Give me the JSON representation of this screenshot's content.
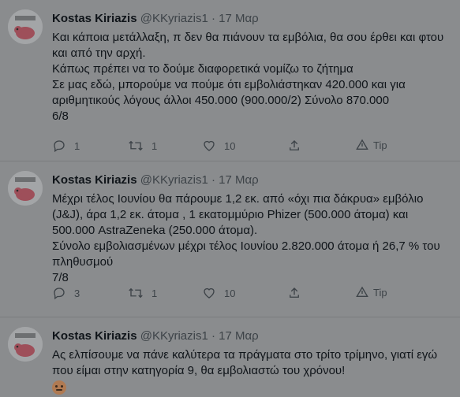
{
  "tweets": [
    {
      "author": "Kostas Kiriazis",
      "handle": "@KKyriazis1",
      "separator": "·",
      "date": "17 Μαρ",
      "lines": [
        "Και κάποια μετάλλαξη, π δεν θα πιάνουν τα εμβόλια, θα σου έρθει και φτου και από την αρχή.",
        "Κάπως πρέπει να το δούμε διαφορετικά νομίζω το ζήτημα",
        "Σε μας εδώ, μπορούμε να πούμε ότι εμβολιάστηκαν 420.000 και για αριθμητικούς λόγους άλλοι  450.000 (900.000/2)  Σύνολο 870.000",
        "6/8"
      ],
      "replies": "1",
      "retweets": "1",
      "likes": "10",
      "tip": "Tip"
    },
    {
      "author": "Kostas Kiriazis",
      "handle": "@KKyriazis1",
      "separator": "·",
      "date": "17 Μαρ",
      "lines": [
        "Μέχρι τέλος Ιουνίου θα πάρουμε  1,2 εκ.  από  «όχι πια δάκρυα» εμβόλιο (J&J), άρα 1,2 εκ. άτομα , 1 εκατομμύριο Phizer (500.000 άτομα)  και 500.000 AstraZeneka (250.000 άτομα).",
        "Σύνολο εμβολιασμένων μέχρι τέλος Ιουνίου  2.820.000 άτομα ή 26,7 % του πληθυσμού",
        "7/8"
      ],
      "replies": "3",
      "retweets": "1",
      "likes": "10",
      "tip": "Tip"
    },
    {
      "author": "Kostas Kiriazis",
      "handle": "@KKyriazis1",
      "separator": "·",
      "date": "17 Μαρ",
      "lines": [
        "Ας ελπίσουμε να πάνε καλύτερα τα πράγματα στο τρίτο τρίμηνο, γιατί εγώ που είμαι στην κατηγορία 9, θα εμβολιαστώ του χρόνου!"
      ],
      "emoji": "weary-face-emoji"
    }
  ],
  "colors": {
    "background": "#8a8c8e",
    "text": "#0f1419",
    "secondary": "#3d4348"
  }
}
